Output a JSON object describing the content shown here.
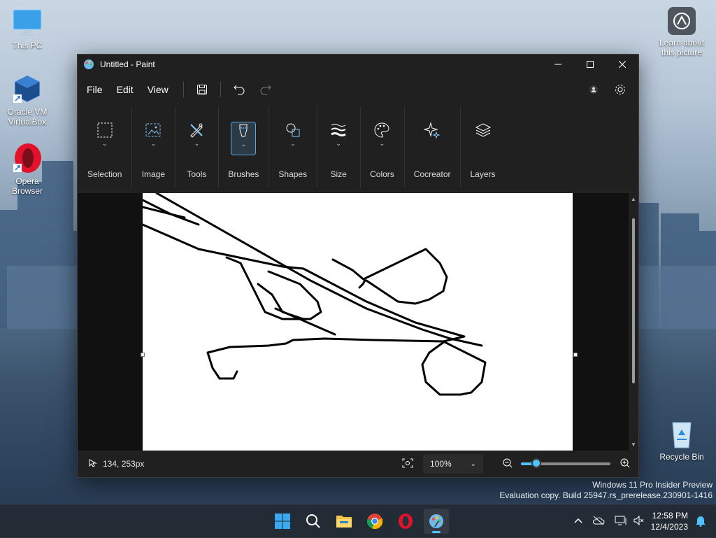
{
  "desktop": {
    "icons": [
      {
        "label": "This PC"
      },
      {
        "label": "Oracle VM VirtualBox"
      },
      {
        "label": "Opera Browser"
      },
      {
        "label": "Recycle Bin"
      }
    ],
    "learn_picture": "Learn about this picture"
  },
  "window": {
    "title": "Untitled - Paint",
    "menu": [
      "File",
      "Edit",
      "View"
    ],
    "ribbon": [
      {
        "label": "Selection",
        "icon": "selection-icon"
      },
      {
        "label": "Image",
        "icon": "image-icon"
      },
      {
        "label": "Tools",
        "icon": "tools-icon"
      },
      {
        "label": "Brushes",
        "icon": "brush-icon"
      },
      {
        "label": "Shapes",
        "icon": "shapes-icon"
      },
      {
        "label": "Size",
        "icon": "size-icon"
      },
      {
        "label": "Colors",
        "icon": "palette-icon"
      },
      {
        "label": "Cocreator",
        "icon": "sparkle-icon"
      },
      {
        "label": "Layers",
        "icon": "layers-icon"
      }
    ],
    "status": {
      "cursor_position": "134, 253px",
      "zoom": "100%",
      "zoom_slider_fraction": 0.17
    }
  },
  "watermark": {
    "line1": "Windows 11 Pro Insider Preview",
    "line2": "Evaluation copy. Build 25947.rs_prerelease.230901-1416"
  },
  "taskbar": {
    "time": "12:58 PM",
    "date": "12/4/2023"
  },
  "colors": {
    "accent": "#4cc2ff",
    "window_bg": "#202020",
    "opera_red": "#e3122c"
  }
}
